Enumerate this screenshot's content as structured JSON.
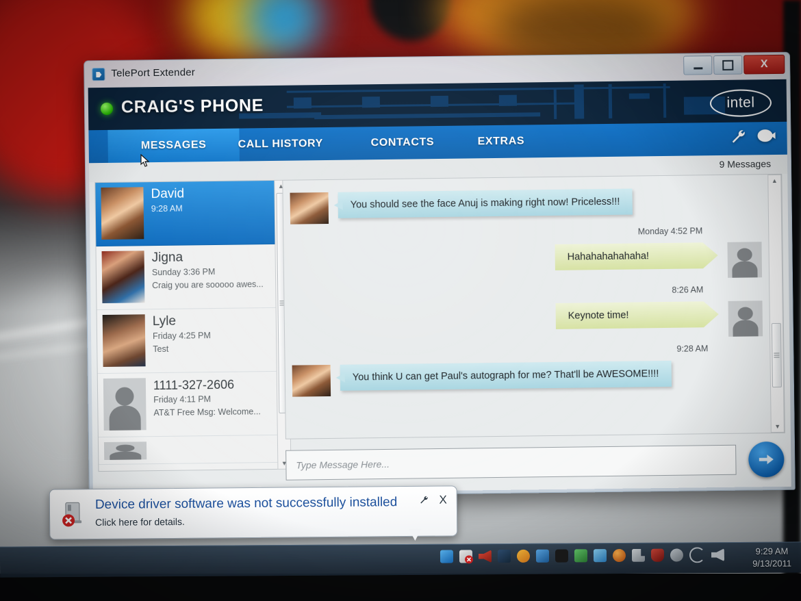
{
  "window": {
    "title": "TelePort Extender",
    "app_icon": "app-icon",
    "controls": {
      "minimize": "–",
      "maximize": "□",
      "close": "X"
    }
  },
  "app_header": {
    "phone_name": "CRAIG'S PHONE",
    "status": "connected",
    "brand": "intel"
  },
  "nav": {
    "tabs": [
      {
        "label": "MESSAGES",
        "active": true
      },
      {
        "label": "CALL HISTORY",
        "active": false
      },
      {
        "label": "CONTACTS",
        "active": false
      },
      {
        "label": "EXTRAS",
        "active": false
      }
    ],
    "icons": [
      "wrench-icon",
      "chat-bubble-icon"
    ]
  },
  "messages_panel": {
    "count_label": "9 Messages",
    "conversations": [
      {
        "name": "David",
        "time": "9:28 AM",
        "preview": "",
        "selected": true,
        "avatar": "photo-david"
      },
      {
        "name": "Jigna",
        "time": "Sunday 3:36 PM",
        "preview": "Craig you are sooooo awes...",
        "selected": false,
        "avatar": "photo-jigna"
      },
      {
        "name": "Lyle",
        "time": "Friday 4:25 PM",
        "preview": "Test",
        "selected": false,
        "avatar": "photo-lyle"
      },
      {
        "name": "1111-327-2606",
        "time": "Friday 4:11 PM",
        "preview": "AT&T Free Msg: Welcome...",
        "selected": false,
        "avatar": "silhouette"
      }
    ],
    "thread": [
      {
        "dir": "in",
        "text": "You should see the face Anuj is making right now!  Priceless!!!",
        "stamp": "",
        "avatar": "photo-david"
      },
      {
        "dir": "out",
        "text": "Hahahahahahaha!",
        "stamp": "Monday 4:52 PM",
        "avatar": "silhouette"
      },
      {
        "dir": "out",
        "text": "Keynote time!",
        "stamp": "8:26 AM",
        "avatar": "silhouette"
      },
      {
        "dir": "in",
        "text": "You think U can get Paul's autograph for me? That'll be AWESOME!!!!",
        "stamp": "9:28 AM",
        "avatar": "photo-david"
      }
    ],
    "composer": {
      "placeholder": "Type Message Here...",
      "send_icon": "send-arrow-icon"
    }
  },
  "notification": {
    "title": "Device driver software was not successfully installed",
    "subtitle": "Click here for details.",
    "close_label": "X",
    "options_icon": "wrench-icon",
    "icon": "device-error-icon"
  },
  "taskbar": {
    "clock_time": "9:29 AM",
    "clock_date": "9/13/2011",
    "tray_icons": [
      "messenger-icon",
      "error-icon",
      "speaker-red-icon",
      "network-icon",
      "orange-icon",
      "blue-icon",
      "black-circle-icon",
      "green-icon",
      "display-icon",
      "orange-ball-icon",
      "flag-icon",
      "red-shield-icon",
      "person-icon",
      "sync-icon",
      "volume-icon"
    ]
  },
  "colors": {
    "accent_blue": "#1273c8",
    "header_navy": "#0b2239",
    "incoming_bubble": "#bfe2ea",
    "outgoing_bubble": "#e2ebbb",
    "status_green": "#33cc00",
    "close_red": "#c22a22"
  }
}
